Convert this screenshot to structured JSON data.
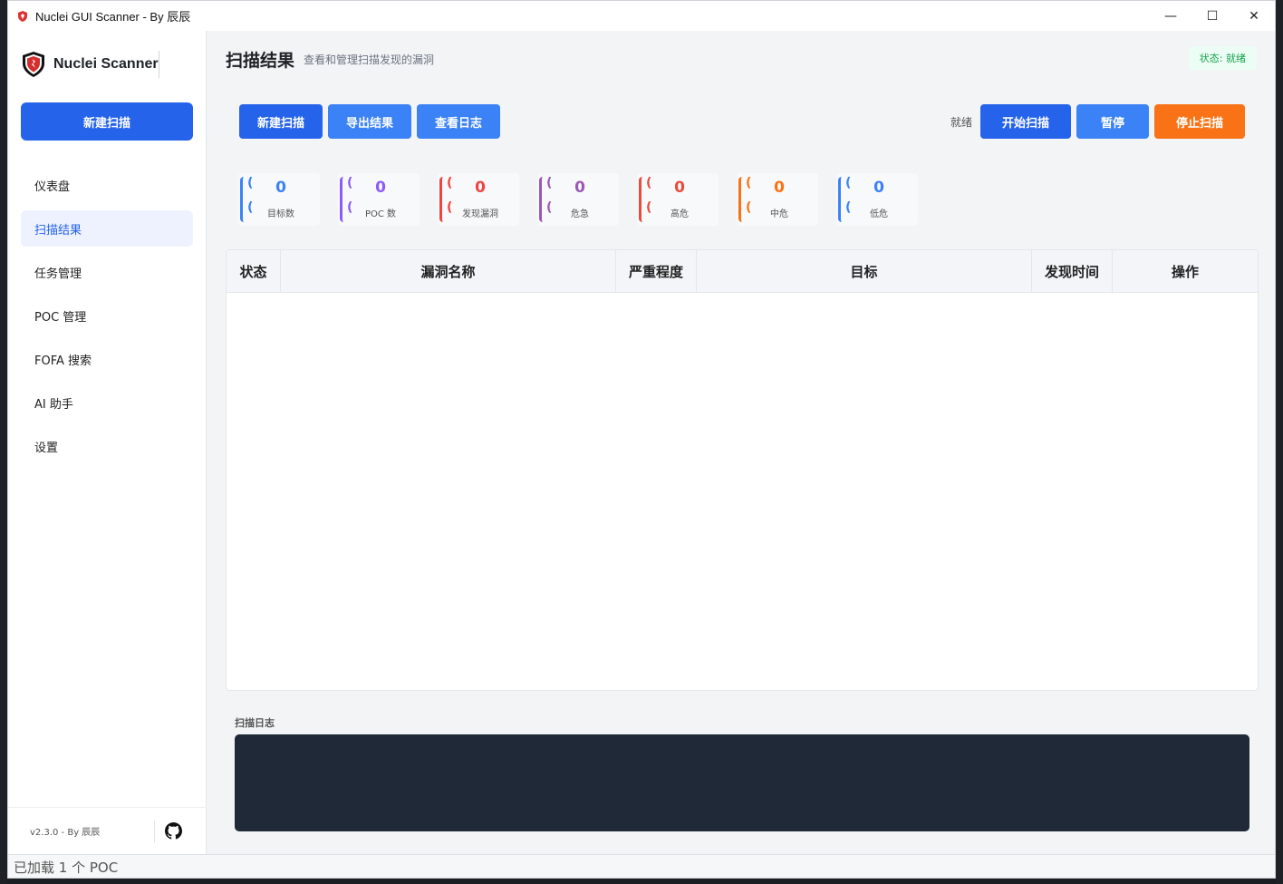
{
  "window": {
    "title": "Nuclei GUI Scanner - By 辰辰",
    "controls": {
      "minimize": "—",
      "maximize": "☐",
      "close": "✕"
    }
  },
  "sidebar": {
    "brand": "Nuclei Scanner",
    "new_scan": "新建扫描",
    "items": [
      {
        "label": "仪表盘"
      },
      {
        "label": "扫描结果",
        "active": true
      },
      {
        "label": "任务管理"
      },
      {
        "label": "POC 管理"
      },
      {
        "label": "FOFA 搜索"
      },
      {
        "label": "AI 助手"
      },
      {
        "label": "设置"
      }
    ],
    "version": "v2.3.0 - By 辰辰"
  },
  "header": {
    "title": "扫描结果",
    "subtitle": "查看和管理扫描发现的漏洞",
    "status": "状态: 就绪"
  },
  "toolbar": {
    "new_scan": "新建扫描",
    "export": "导出结果",
    "view_log": "查看日志",
    "ready": "就绪",
    "start": "开始扫描",
    "pause": "暂停",
    "stop": "停止扫描"
  },
  "stats": [
    {
      "value": "0",
      "label": "目标数",
      "color": "#3b82f6"
    },
    {
      "value": "0",
      "label": "POC 数",
      "color": "#8b5cf6"
    },
    {
      "value": "0",
      "label": "发现漏洞",
      "color": "#ef4444"
    },
    {
      "value": "0",
      "label": "危急",
      "color": "#9b59b6"
    },
    {
      "value": "0",
      "label": "高危",
      "color": "#e74c3c"
    },
    {
      "value": "0",
      "label": "中危",
      "color": "#f97316"
    },
    {
      "value": "0",
      "label": "低危",
      "color": "#3b82f6"
    }
  ],
  "table": {
    "columns": [
      "状态",
      "漏洞名称",
      "严重程度",
      "目标",
      "发现时间",
      "操作"
    ],
    "rows": []
  },
  "log": {
    "label": "扫描日志"
  },
  "statusbar": {
    "text": "已加载 1 个 POC"
  },
  "colors": {
    "primary": "#2563eb",
    "accent": "#3b82f6",
    "danger": "#f97316",
    "log_bg": "#1f2937"
  }
}
